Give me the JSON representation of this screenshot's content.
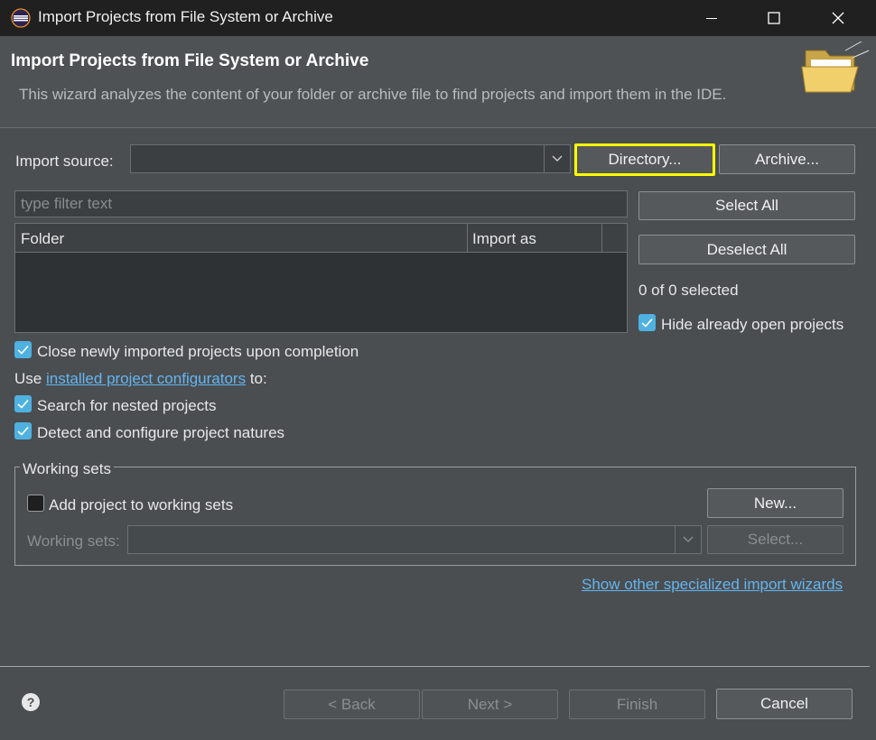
{
  "window": {
    "title": "Import Projects from File System or Archive",
    "minimize_glyph": "—",
    "maximize_glyph": "☐",
    "close_glyph": "✕"
  },
  "header": {
    "title": "Import Projects from File System or Archive",
    "description": "This wizard analyzes the content of your folder or archive file to find projects and import them in the IDE.",
    "icon": "folder-open-icon"
  },
  "import_source": {
    "label": "Import source:",
    "value": "",
    "directory_button": "Directory...",
    "archive_button": "Archive..."
  },
  "filter": {
    "placeholder": "type filter text",
    "value": ""
  },
  "table": {
    "columns": [
      "Folder",
      "Import as"
    ],
    "rows": []
  },
  "selection": {
    "select_all": "Select All",
    "deselect_all": "Deselect All",
    "status": "0 of 0 selected",
    "hide_open_label": "Hide already open projects",
    "hide_open_checked": true
  },
  "options": {
    "close_after_label": "Close newly imported projects upon completion",
    "close_after_checked": true,
    "use_prefix": "Use",
    "configurators_link": "installed project configurators",
    "use_suffix": "to:",
    "nested_label": "Search for nested projects",
    "nested_checked": true,
    "natures_label": "Detect and configure project natures",
    "natures_checked": true
  },
  "working_sets": {
    "group_label": "Working sets",
    "add_label": "Add project to working sets",
    "add_checked": false,
    "new_button": "New...",
    "sets_label": "Working sets:",
    "sets_value": "",
    "select_button": "Select..."
  },
  "specialized_link": "Show other specialized import wizards",
  "footer": {
    "help_glyph": "?",
    "back": "< Back",
    "next": "Next >",
    "finish": "Finish",
    "cancel": "Cancel"
  },
  "colors": {
    "highlight": "#ffff00",
    "checkbox_on": "#4fb1e0",
    "link": "#64b5f0"
  }
}
